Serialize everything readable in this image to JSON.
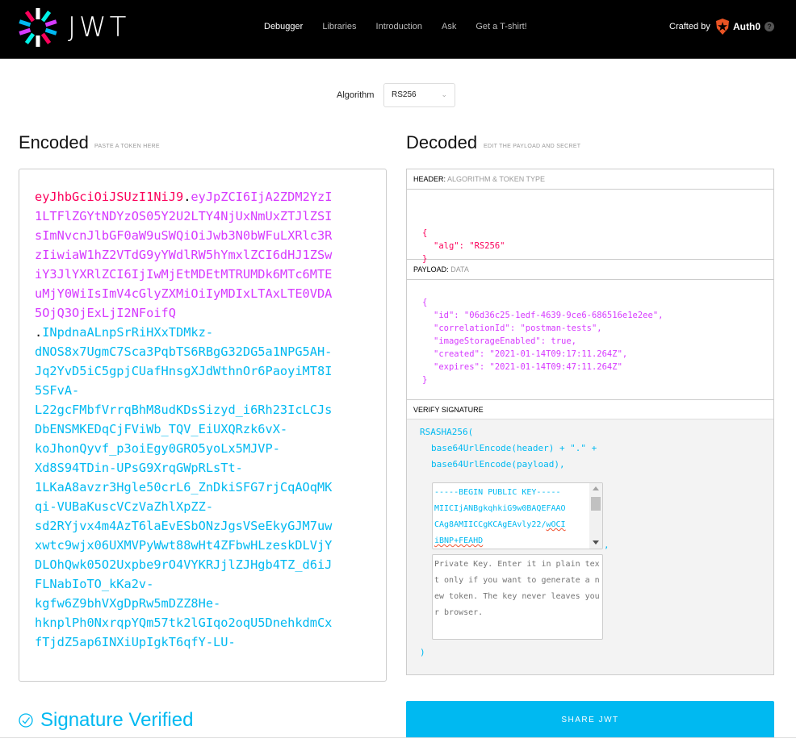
{
  "nav": {
    "logo_text": "JWT",
    "items": [
      {
        "label": "Debugger",
        "active": true
      },
      {
        "label": "Libraries",
        "active": false
      },
      {
        "label": "Introduction",
        "active": false
      },
      {
        "label": "Ask",
        "active": false
      },
      {
        "label": "Get a T-shirt!",
        "active": false
      }
    ],
    "crafted_by": "Crafted by",
    "brand": "Auth0",
    "help": "?"
  },
  "algorithm": {
    "label": "Algorithm",
    "selected": "RS256"
  },
  "encoded": {
    "title": "Encoded",
    "subtitle": "PASTE A TOKEN HERE",
    "header_part": "eyJhbGciOiJSUzI1NiJ9",
    "payload_part": "eyJpZCI6IjA2ZDM2YzI1LTFlZGYtNDYzOS05Y2U2LTY4NjUxNmUxZTJlZSIsImNvcnJlbGF0aW9uSWQiOiJwb3N0bWFuLXRlc3RzIiwiaW1hZ2VTdG9yYWdlRW5hYmxlZCI6dHJ1ZSwiY3JlYXRlZCI6IjIwMjEtMDEtMTRUMDk6MTc6MTEuMjY0WiIsImV4cGlyZXMiOiIyMDIxLTAxLTE0VDA5OjQ3OjExLjI2NFoifQ",
    "signature_part": "INpdnaALnpSrRiHXxTDMkz-\ndNOS8x7UgmC7Sca3PqbTS6RBgG32DG5a1NPG5AH-\nJq2YvD5iC5gpjCUafHnsgXJdWthnOr6PaoyiMT8I5SFvA-\nL22gcFMbfVrrqBhM8udKDsSizyd_i6Rh23IcLCJsDbENSMKEDqCjFViWb_TQV_EiUXQRzk6vX-\nkoJhonQyvf_p3oiEgy0GRO5yoLx5MJVP-\nXd8S94TDin-UPsG9XrqGWpRLsTt-\n1LKaA8avzr3Hgle50crL6_ZnDkiSFG7rjCqAOqMKqi-VUBaKuscVCzVaZhlXpZZ-\nsd2RYjvx4m4AzT6laEvESbONzJgsVSeEkyGJM7uwxwtc9wjx06UXMVPyWwt88wHt4ZFbwHLzeskDLVjYDLOhQwk05O2Uxpbe9rO4VYKRJjlZJHgb4TZ_d6iJFLNabIoTO_kKa2v-\nkgfw6Z9bhVXgDpRw5mDZZ8He-\nhknplPh0NxrqpYQm57tk2lGIqo2oqU5DnehkdmCxfTjdZ5ap6INXiUpIgkT6qfY-LU-"
  },
  "decoded": {
    "title": "Decoded",
    "subtitle": "EDIT THE PAYLOAD AND SECRET",
    "header_section": {
      "label": "HEADER:",
      "sublabel": "ALGORITHM & TOKEN TYPE",
      "open": "{",
      "lines": [
        "\"alg\": \"RS256\""
      ],
      "close": "}"
    },
    "payload_section": {
      "label": "PAYLOAD:",
      "sublabel": "DATA",
      "open": "{",
      "lines": [
        "\"id\": \"06d36c25-1edf-4639-9ce6-686516e1e2ee\",",
        "\"correlationId\": \"postman-tests\",",
        "\"imageStorageEnabled\": true,",
        "\"created\": \"2021-01-14T09:17:11.264Z\",",
        "\"expires\": \"2021-01-14T09:47:11.264Z\""
      ],
      "close": "}"
    },
    "verify_section": {
      "label": "VERIFY SIGNATURE",
      "fn_open": "RSASHA256(",
      "line1": "base64UrlEncode(header) + \".\" +",
      "line2": "base64UrlEncode(payload),",
      "public_key_visible": [
        "-----BEGIN PUBLIC KEY-----",
        "MIICIjANBgkqhkiG9w0BAQEFAAO",
        "CAg8AMIICCgKCAgEAvly22/",
        "wOCI",
        "iBNP+FEAHD"
      ],
      "comma": ",",
      "private_key_placeholder": "Private Key. Enter it in plain text only if you want to generate a new token. The key never leaves your browser.",
      "fn_close": ")"
    }
  },
  "status": {
    "text": "Signature Verified",
    "color": "#00b9f1"
  },
  "share_button": "SHARE JWT",
  "colors": {
    "header": "#fb015b",
    "payload": "#d63aff",
    "signature": "#00b9f1"
  }
}
